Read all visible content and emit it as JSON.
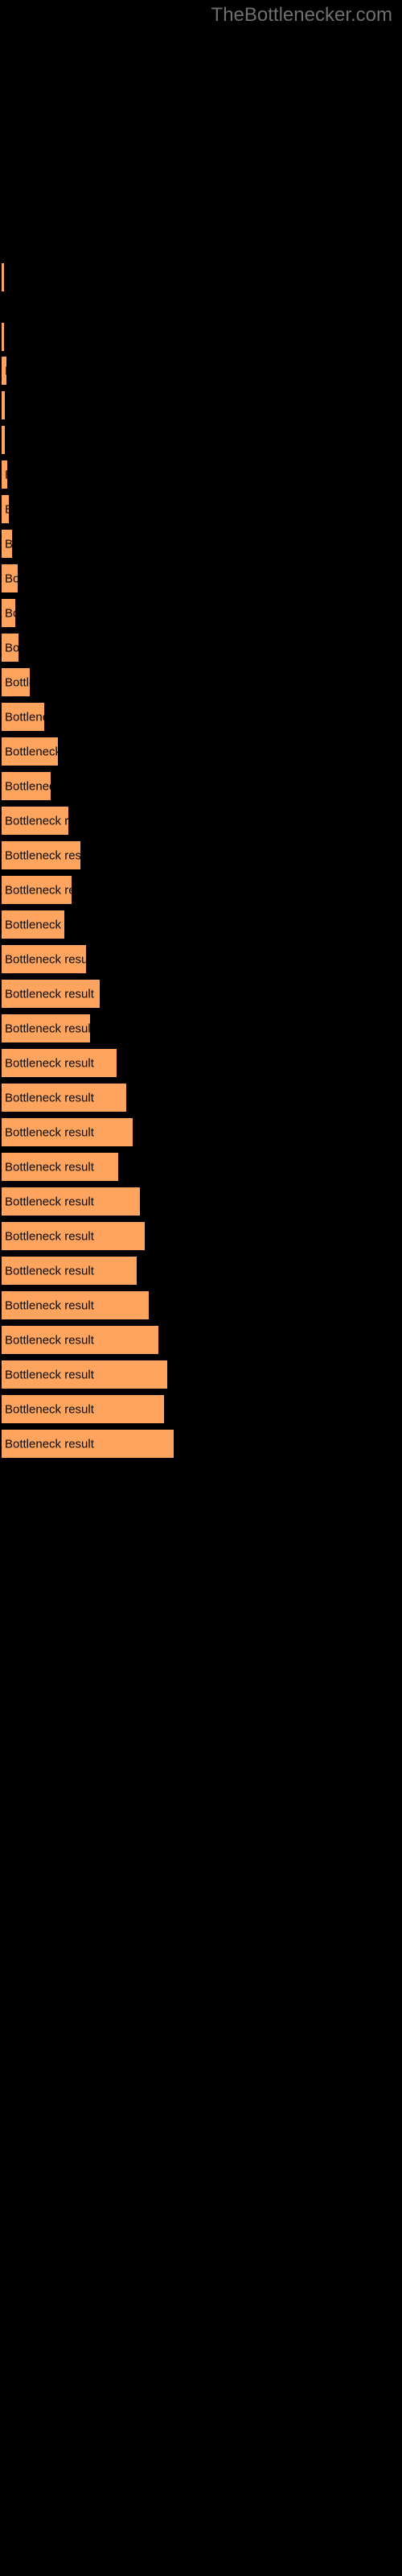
{
  "header": {
    "site_title": "TheBottlenecker.com",
    "title_color": "#6f6f6f"
  },
  "colors": {
    "background": "#000000",
    "bar_fill": "#ffa45e",
    "bar_border": "#000000",
    "bar_label_text": "#0a0a0a"
  },
  "chart_data": {
    "type": "bar",
    "orientation": "horizontal",
    "title": "",
    "subtitle": "",
    "xlabel": "",
    "ylabel": "",
    "grid": false,
    "legend": null,
    "bar_label_text": "Bottleneck result",
    "note": "Horizontal bar chart on black background. Every bar is annotated with the text 'Bottleneck result', which is clipped to the bar width. Bar lengths increase monotonically from top to bottom. Values below are bar pixel lengths read off the image (no numeric axis ticks are rendered).",
    "categories": [
      "Bottleneck result",
      "Bottleneck result",
      "Bottleneck result",
      "Bottleneck result",
      "Bottleneck result",
      "Bottleneck result",
      "Bottleneck result",
      "Bottleneck result",
      "Bottleneck result",
      "Bottleneck result",
      "Bottleneck result",
      "Bottleneck result",
      "Bottleneck result",
      "Bottleneck result",
      "Bottleneck result",
      "Bottleneck result",
      "Bottleneck result",
      "Bottleneck result",
      "Bottleneck result",
      "Bottleneck result",
      "Bottleneck result",
      "Bottleneck result",
      "Bottleneck result",
      "Bottleneck result",
      "Bottleneck result",
      "Bottleneck result",
      "Bottleneck result",
      "Bottleneck result",
      "Bottleneck result",
      "Bottleneck result",
      "Bottleneck result",
      "Bottleneck result",
      "Bottleneck result",
      "Bottleneck result"
    ],
    "values": [
      3,
      3,
      6,
      4,
      4,
      7,
      9,
      13,
      20,
      17,
      21,
      35,
      53,
      70,
      61,
      83,
      98,
      87,
      78,
      105,
      122,
      110,
      143,
      155,
      163,
      145,
      172,
      178,
      168,
      183,
      195,
      206,
      202,
      214
    ],
    "xlim": [
      0,
      214
    ],
    "bars": [
      {
        "index": 0,
        "label": "Bottleneck result",
        "value": 3,
        "top": 325,
        "height": 38
      },
      {
        "index": 1,
        "label": "Bottleneck result",
        "value": 3,
        "top": 399,
        "height": 38
      },
      {
        "index": 2,
        "label": "Bottleneck result",
        "value": 6,
        "top": 441,
        "height": 38
      },
      {
        "index": 3,
        "label": "Bottleneck result",
        "value": 4,
        "top": 484,
        "height": 38
      },
      {
        "index": 4,
        "label": "Bottleneck result",
        "value": 4,
        "top": 527,
        "height": 38
      },
      {
        "index": 5,
        "label": "Bottleneck result",
        "value": 7,
        "top": 570,
        "height": 38
      },
      {
        "index": 6,
        "label": "Bottleneck result",
        "value": 9,
        "top": 613,
        "height": 38
      },
      {
        "index": 7,
        "label": "Bottleneck result",
        "value": 13,
        "top": 656,
        "height": 38
      },
      {
        "index": 8,
        "label": "Bottleneck result",
        "value": 20,
        "top": 699,
        "height": 38
      },
      {
        "index": 9,
        "label": "Bottleneck result",
        "value": 17,
        "top": 742,
        "height": 38
      },
      {
        "index": 10,
        "label": "Bottleneck result",
        "value": 21,
        "top": 785,
        "height": 38
      },
      {
        "index": 11,
        "label": "Bottleneck result",
        "value": 35,
        "top": 828,
        "height": 38
      },
      {
        "index": 12,
        "label": "Bottleneck result",
        "value": 53,
        "top": 871,
        "height": 38
      },
      {
        "index": 13,
        "label": "Bottleneck result",
        "value": 70,
        "top": 914,
        "height": 38
      },
      {
        "index": 14,
        "label": "Bottleneck result",
        "value": 61,
        "top": 957,
        "height": 38
      },
      {
        "index": 15,
        "label": "Bottleneck result",
        "value": 83,
        "top": 1000,
        "height": 38
      },
      {
        "index": 16,
        "label": "Bottleneck result",
        "value": 98,
        "top": 1043,
        "height": 38
      },
      {
        "index": 17,
        "label": "Bottleneck result",
        "value": 87,
        "top": 1086,
        "height": 38
      },
      {
        "index": 18,
        "label": "Bottleneck result",
        "value": 78,
        "top": 1129,
        "height": 38
      },
      {
        "index": 19,
        "label": "Bottleneck result",
        "value": 105,
        "top": 1172,
        "height": 38
      },
      {
        "index": 20,
        "label": "Bottleneck result",
        "value": 122,
        "top": 1215,
        "height": 38
      },
      {
        "index": 21,
        "label": "Bottleneck result",
        "value": 110,
        "top": 1258,
        "height": 38
      },
      {
        "index": 22,
        "label": "Bottleneck result",
        "value": 143,
        "top": 1301,
        "height": 38
      },
      {
        "index": 23,
        "label": "Bottleneck result",
        "value": 155,
        "top": 1344,
        "height": 38
      },
      {
        "index": 24,
        "label": "Bottleneck result",
        "value": 163,
        "top": 1387,
        "height": 38
      },
      {
        "index": 25,
        "label": "Bottleneck result",
        "value": 145,
        "top": 1430,
        "height": 38
      },
      {
        "index": 26,
        "label": "Bottleneck result",
        "value": 172,
        "top": 1473,
        "height": 38
      },
      {
        "index": 27,
        "label": "Bottleneck result",
        "value": 178,
        "top": 1516,
        "height": 38
      },
      {
        "index": 28,
        "label": "Bottleneck result",
        "value": 168,
        "top": 1559,
        "height": 38
      },
      {
        "index": 29,
        "label": "Bottleneck result",
        "value": 183,
        "top": 1602,
        "height": 38
      },
      {
        "index": 30,
        "label": "Bottleneck result",
        "value": 195,
        "top": 1645,
        "height": 38
      },
      {
        "index": 31,
        "label": "Bottleneck result",
        "value": 206,
        "top": 1688,
        "height": 38
      },
      {
        "index": 32,
        "label": "Bottleneck result",
        "value": 202,
        "top": 1731,
        "height": 38
      },
      {
        "index": 33,
        "label": "Bottleneck result",
        "value": 214,
        "top": 1774,
        "height": 38
      }
    ]
  }
}
